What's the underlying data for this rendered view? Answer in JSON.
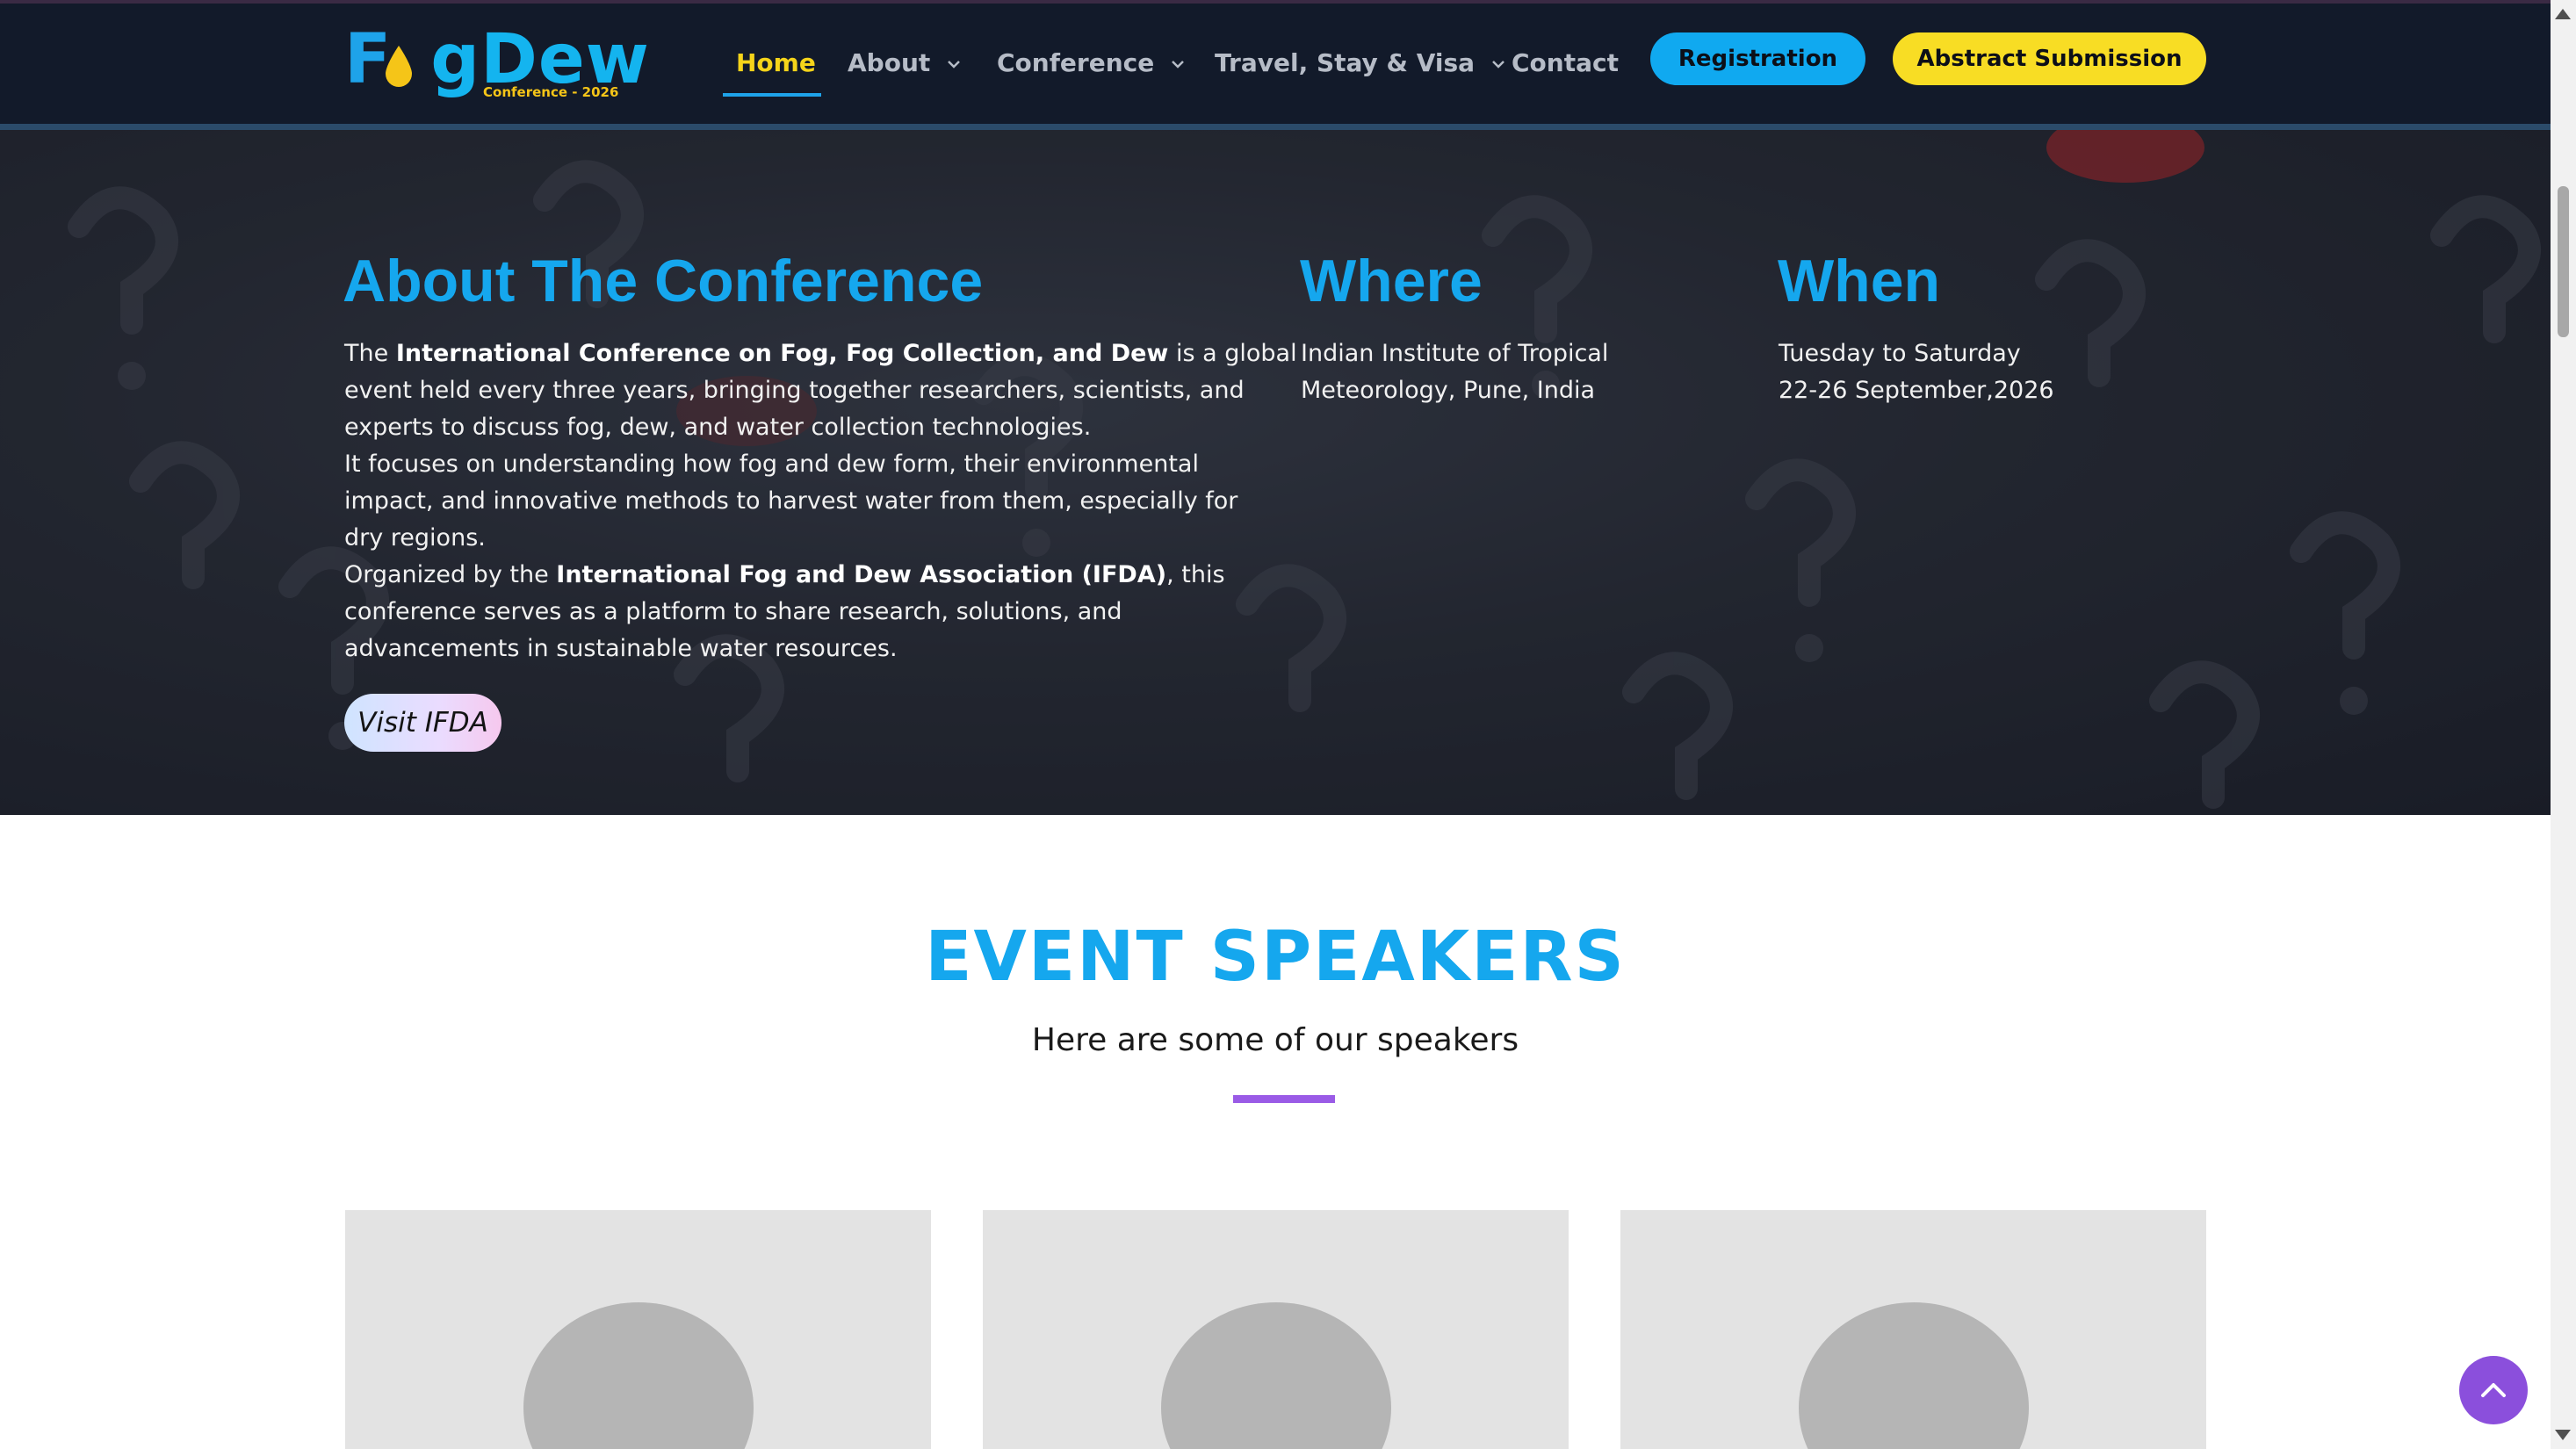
{
  "logo": {
    "part1": "F",
    "part2": "gDew",
    "tagline": "Conference - 2026"
  },
  "nav": {
    "items": [
      {
        "label": "Home",
        "active": true
      },
      {
        "label": "About",
        "dropdown": true
      },
      {
        "label": "Conference",
        "dropdown": true
      },
      {
        "label": "Travel, Stay & Visa",
        "dropdown": true
      },
      {
        "label": "Contact"
      }
    ],
    "registration_label": "Registration",
    "abstract_label": "Abstract Submission"
  },
  "hero": {
    "about_title": "About The Conference",
    "p1_pre": "The ",
    "p1_bold": "International Conference on Fog, Fog Collection, and Dew",
    "p1_line1_post": " is a global",
    "p1_line2": "event held every three years, bringing together researchers, scientists, and",
    "p1_line3": "experts to discuss fog, dew, and water collection technologies.",
    "p2_line1": "It focuses on understanding how fog and dew form, their environmental",
    "p2_line2": "impact, and innovative methods to harvest water from them, especially for",
    "p2_line3": "dry regions.",
    "p3_pre": "Organized by the ",
    "p3_bold": "International Fog and Dew Association (IFDA)",
    "p3_line1_post": ", this",
    "p3_line2": "conference serves as a platform to share research, solutions, and",
    "p3_line3": "advancements in sustainable water resources.",
    "visit_label": "Visit IFDA",
    "where_title": "Where",
    "where_line1": "Indian Institute of Tropical",
    "where_line2": "Meteorology, Pune, India",
    "when_title": "When",
    "when_line1": "Tuesday to Saturday",
    "when_line2": "22-26 September,2026"
  },
  "speakers": {
    "title": "EVENT SPEAKERS",
    "subtitle": "Here are some of our speakers"
  },
  "colors": {
    "accent_blue": "#15a7ee",
    "nav_active": "#f5d41a",
    "registration_bg": "#10a9f0",
    "abstract_bg": "#f8dd24",
    "purple": "#8b4fdc",
    "navbar_bg": "#121a2a"
  },
  "icons": {
    "dropdown": "chevron-down-icon",
    "back_to_top": "chevron-up-icon",
    "logo_drop": "water-drop-icon"
  }
}
